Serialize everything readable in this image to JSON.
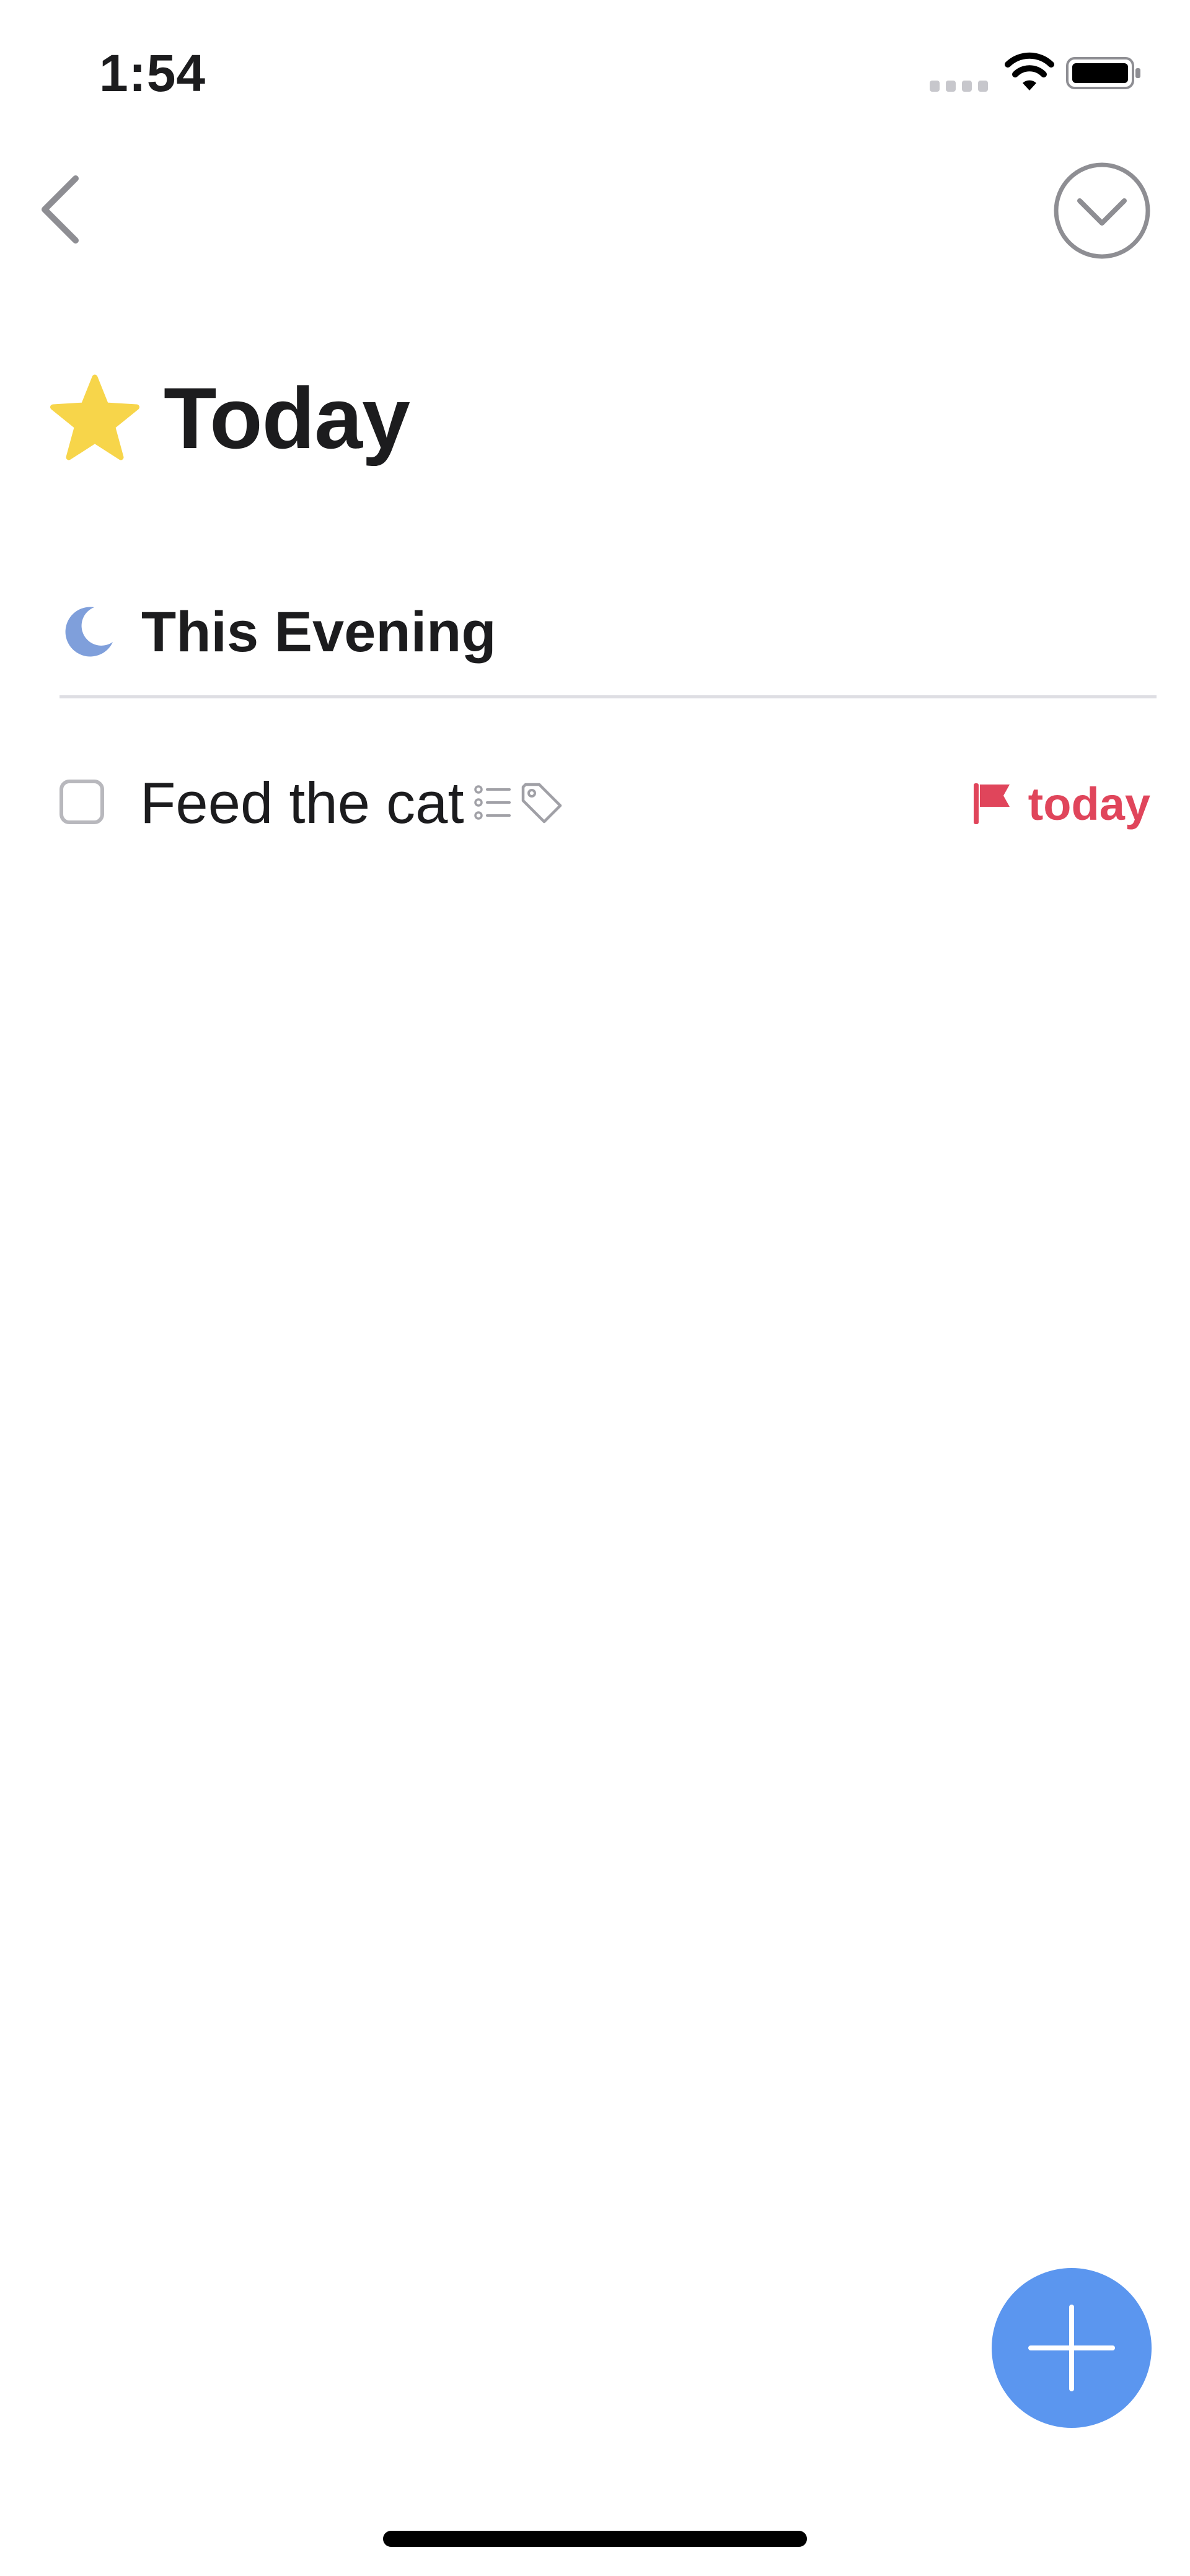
{
  "status_bar": {
    "time": "1:54",
    "icons": [
      "cellular-signal-icon",
      "wifi-icon",
      "battery-icon"
    ]
  },
  "nav": {
    "back_icon": "chevron-left-icon",
    "menu_icon": "chevron-down-circle-icon"
  },
  "header": {
    "icon": "star-icon",
    "title": "Today"
  },
  "sections": [
    {
      "icon": "moon-icon",
      "title": "This Evening",
      "tasks": [
        {
          "title": "Feed the cat",
          "completed": false,
          "indicators": [
            "checklist-icon",
            "tag-icon"
          ],
          "due_icon": "flag-icon",
          "due_label": "today"
        }
      ]
    }
  ],
  "fab": {
    "icon": "plus-icon"
  },
  "colors": {
    "accent_blue": "#5b96ef",
    "due_red": "#e0455b",
    "star_yellow": "#f7d54a",
    "moon_blue": "#7f9fdb",
    "text_primary": "#1c1c1e",
    "muted_gray": "#b8b8bd"
  }
}
